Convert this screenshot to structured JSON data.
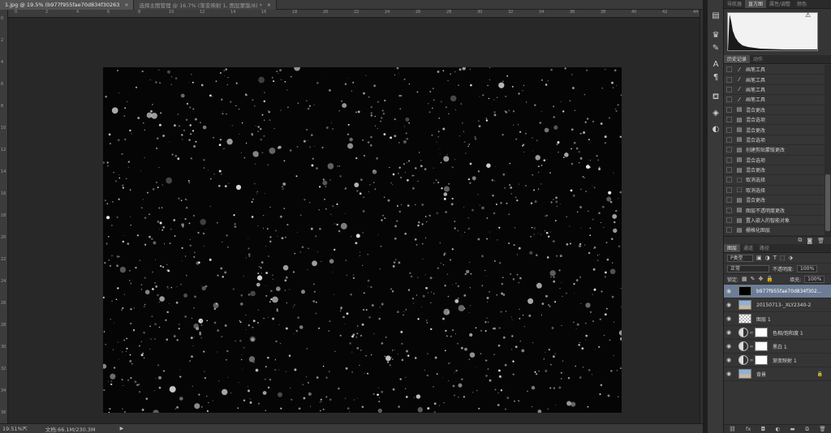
{
  "tabs": [
    {
      "label": "1.jpg @ 19.5% (b977f955fae70d834f30263",
      "active": true
    },
    {
      "label": "选择主图管理 @ 16.7% (渐变映射 1, 图层蒙版/8) *",
      "active": false
    }
  ],
  "ruler_top_labels": [
    "0",
    "2",
    "4",
    "6",
    "8",
    "10",
    "12",
    "14",
    "16",
    "18",
    "20",
    "22",
    "24",
    "26",
    "28",
    "30",
    "32",
    "34",
    "36",
    "38",
    "40",
    "42",
    "44"
  ],
  "ruler_left_labels": [
    "0",
    "2",
    "4",
    "6",
    "8",
    "10",
    "12",
    "14",
    "16",
    "18",
    "20",
    "22",
    "24",
    "26",
    "28",
    "30",
    "32",
    "34",
    "36"
  ],
  "status": {
    "zoom": "19.51%",
    "doc": "文档:66.1M/230.3M"
  },
  "histogram_tabs": [
    "导航器",
    "直方图",
    "属性/调整",
    "颜色"
  ],
  "history_tabs": [
    "历史记录",
    "动作"
  ],
  "history_items": [
    {
      "icon": "brush-icon",
      "label": "画笔工具"
    },
    {
      "icon": "brush-icon",
      "label": "画笔工具"
    },
    {
      "icon": "brush-icon",
      "label": "画笔工具"
    },
    {
      "icon": "brush-icon",
      "label": "画笔工具"
    },
    {
      "icon": "doc-icon",
      "label": "混合更改"
    },
    {
      "icon": "doc-icon",
      "label": "混合选项"
    },
    {
      "icon": "doc-icon",
      "label": "混合更改"
    },
    {
      "icon": "doc-icon",
      "label": "混合选项"
    },
    {
      "icon": "doc-icon",
      "label": "创建剪贴蒙版更改"
    },
    {
      "icon": "doc-icon",
      "label": "混合选项"
    },
    {
      "icon": "doc-icon",
      "label": "混合更改"
    },
    {
      "icon": "marquee-icon",
      "label": "取消选择"
    },
    {
      "icon": "marquee-icon",
      "label": "取消选择"
    },
    {
      "icon": "doc-icon",
      "label": "混合更改"
    },
    {
      "icon": "doc-icon",
      "label": "图层不透明度更改"
    },
    {
      "icon": "doc-icon",
      "label": "置入嵌入的智能对象"
    },
    {
      "icon": "doc-icon",
      "label": "栅格化图层"
    },
    {
      "icon": "doc-icon",
      "label": "置入嵌入的智能对象"
    }
  ],
  "layers_tabs": [
    "图层",
    "通道",
    "路径"
  ],
  "layers_tools": {
    "filter": "P类型",
    "blend": "正常",
    "opacity_label": "不透明度:",
    "opacity": "100%",
    "lock_label": "锁定:",
    "fill_label": "填充:",
    "fill": "100%"
  },
  "layers": [
    {
      "name": "b977f955fae70d834f302...",
      "thumb": "black",
      "selected": true
    },
    {
      "name": "20150713-_XLY2340-2",
      "thumb": "photo"
    },
    {
      "name": "图层 1",
      "thumb": "checker"
    },
    {
      "name": "色相/饱和度 1",
      "thumb": "adjust",
      "mask": true
    },
    {
      "name": "黑白 1",
      "thumb": "adjust",
      "mask": true
    },
    {
      "name": "渐变映射 1",
      "thumb": "adjust",
      "mask": true
    },
    {
      "name": "背景",
      "thumb": "photo",
      "locked": true
    }
  ]
}
